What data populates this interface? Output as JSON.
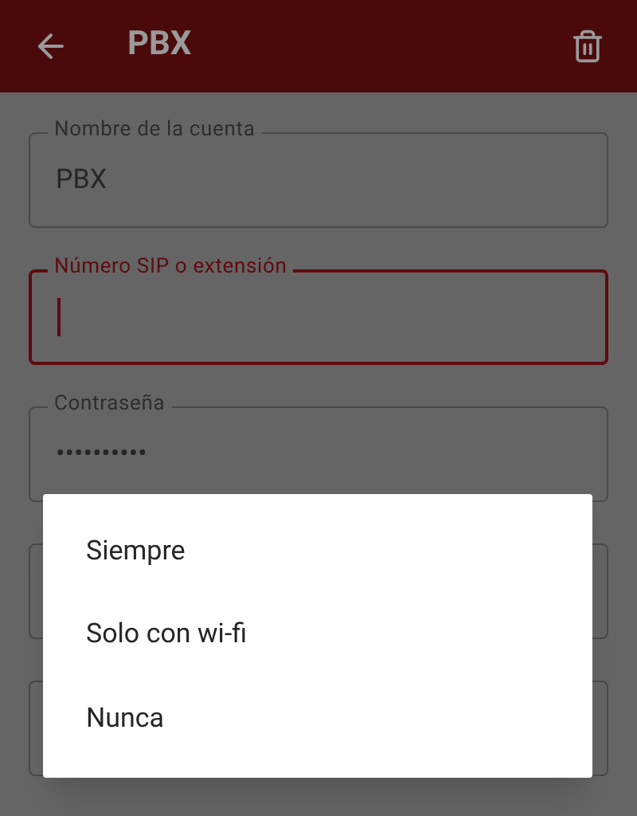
{
  "app_bar": {
    "title": "PBX"
  },
  "fields": [
    {
      "label": "Nombre de la cuenta",
      "value": "PBX",
      "focused": false
    },
    {
      "label": "Número SIP o extensión",
      "focused": true
    },
    {
      "label": "Contraseña",
      "value": "••••••••••",
      "focused": false
    }
  ],
  "dialog": {
    "options": [
      {
        "label": "Siempre"
      },
      {
        "label": "Solo con wi-fi"
      },
      {
        "label": "Nunca"
      }
    ]
  }
}
